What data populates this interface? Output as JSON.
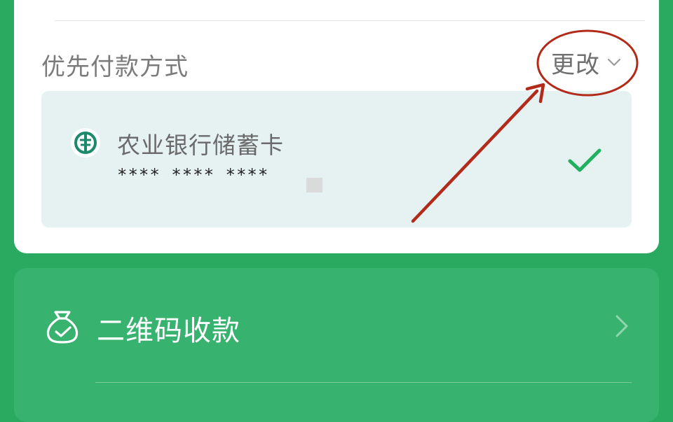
{
  "payment": {
    "section_title": "优先付款方式",
    "change_label": "更改",
    "selected_card": {
      "bank_name": "农业银行储蓄卡",
      "card_number": "**** **** ****",
      "selected": true
    }
  },
  "qr_receive": {
    "label": "二维码收款"
  },
  "icons": {
    "change": "chevron-down-icon",
    "bank": "agricultural-bank-logo-icon",
    "selected": "check-icon",
    "qr": "money-bag-icon",
    "qr_arrow": "chevron-right-icon"
  },
  "colors": {
    "page_background": "#2aaa60",
    "card_background": "#ffffff",
    "selected_card_background": "#e6f2f2",
    "check_green": "#20b05f",
    "annotation_red": "#b22a1a"
  }
}
